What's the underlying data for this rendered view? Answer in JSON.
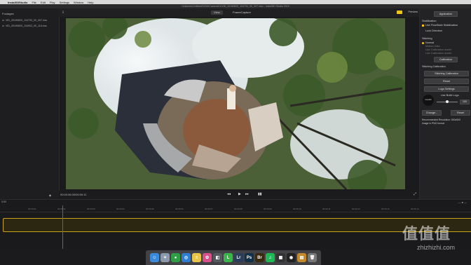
{
  "menubar": {
    "items": [
      "Insta360Studio",
      "File",
      "Edit",
      "Play",
      "Settings",
      "Window",
      "Help"
    ],
    "right": "88%  Thu  10:31"
  },
  "window": {
    "title": "/Volumes/Untitled/DCIM/Camera01/VID_20190820_104733_00_007.insv - Insta360 Studio 2019"
  },
  "toolbar": {
    "view_tab": "View",
    "frame_tab": "FrameCapture"
  },
  "left_panel": {
    "header": "Footages",
    "files": [
      "VID_20190820_104733_00_007.insv",
      "VID_20190820_104903_00_118.insv"
    ]
  },
  "player": {
    "timecode": "00:00:06.00/00:00:11",
    "buttons": [
      "◂◂",
      "▶",
      "▸▸",
      "▮▮"
    ]
  },
  "right_panel": {
    "preview_label": "Preview",
    "apply_button": "Application",
    "stabilization_header": "Stabilization",
    "flowstate": "Use FlowState Stabilization",
    "lock_direction": "Lock Direction",
    "stitching_header": "Stitching",
    "stitch_normal": "Normal",
    "stitch_options": [
      "Motion Data",
      "Use Calibration model",
      "Use Calibration model"
    ],
    "calibration_button": "Calibration",
    "calibrate_header": "Stitching Calibration",
    "stitching_calibration_button": "Stitching Calibration",
    "reset_button": "Reset",
    "logo_settings_button": "Logo Settings",
    "logo_text": "insta360",
    "use_build_logo": "Use Build Logo",
    "logo_value": "100",
    "change_button": "Change...",
    "reset2_button": "Reset",
    "recommended": "Recommended Resolution: 500x500",
    "format": "Image in PNG format"
  },
  "timeline": {
    "start_label": "0:00",
    "ticks": [
      "00:00:01",
      "00:00:02",
      "00:00:03",
      "00:00:04",
      "00:00:05",
      "00:00:06",
      "00:00:07",
      "00:00:08",
      "00:00:09",
      "00:00:10",
      "00:00:11",
      "00:00:12",
      "00:00:13",
      "00:00:14"
    ]
  },
  "dock": {
    "apps": [
      {
        "name": "finder",
        "label": "☺",
        "color": "#3b8ad9"
      },
      {
        "name": "launchpad",
        "label": "✦",
        "color": "#8a9aaa"
      },
      {
        "name": "chrome",
        "label": "●",
        "color": "#2f9e44"
      },
      {
        "name": "safari",
        "label": "◎",
        "color": "#2d7dd2"
      },
      {
        "name": "notes",
        "label": "≡",
        "color": "#e9c44a"
      },
      {
        "name": "photos",
        "label": "✿",
        "color": "#d94f8a"
      },
      {
        "name": "screenshot",
        "label": "◧",
        "color": "#555a60"
      },
      {
        "name": "line",
        "label": "L",
        "color": "#3ab54a"
      },
      {
        "name": "lightroom",
        "label": "Lr",
        "color": "#2a3d5a"
      },
      {
        "name": "photoshop",
        "label": "Ps",
        "color": "#123048"
      },
      {
        "name": "bridge",
        "label": "Br",
        "color": "#3a2a10"
      },
      {
        "name": "spotify",
        "label": "♫",
        "color": "#1db954"
      },
      {
        "name": "grid",
        "label": "▦",
        "color": "#333"
      },
      {
        "name": "insta360",
        "label": "◉",
        "color": "#222"
      },
      {
        "name": "folder",
        "label": "▤",
        "color": "#c28a2a"
      },
      {
        "name": "trash",
        "label": "🗑",
        "color": "#777"
      }
    ]
  },
  "watermark": {
    "big": "值值值",
    "small": "zhizhizhi.com"
  },
  "colors": {
    "accent": "#f2c318",
    "track": "#c9a417"
  }
}
